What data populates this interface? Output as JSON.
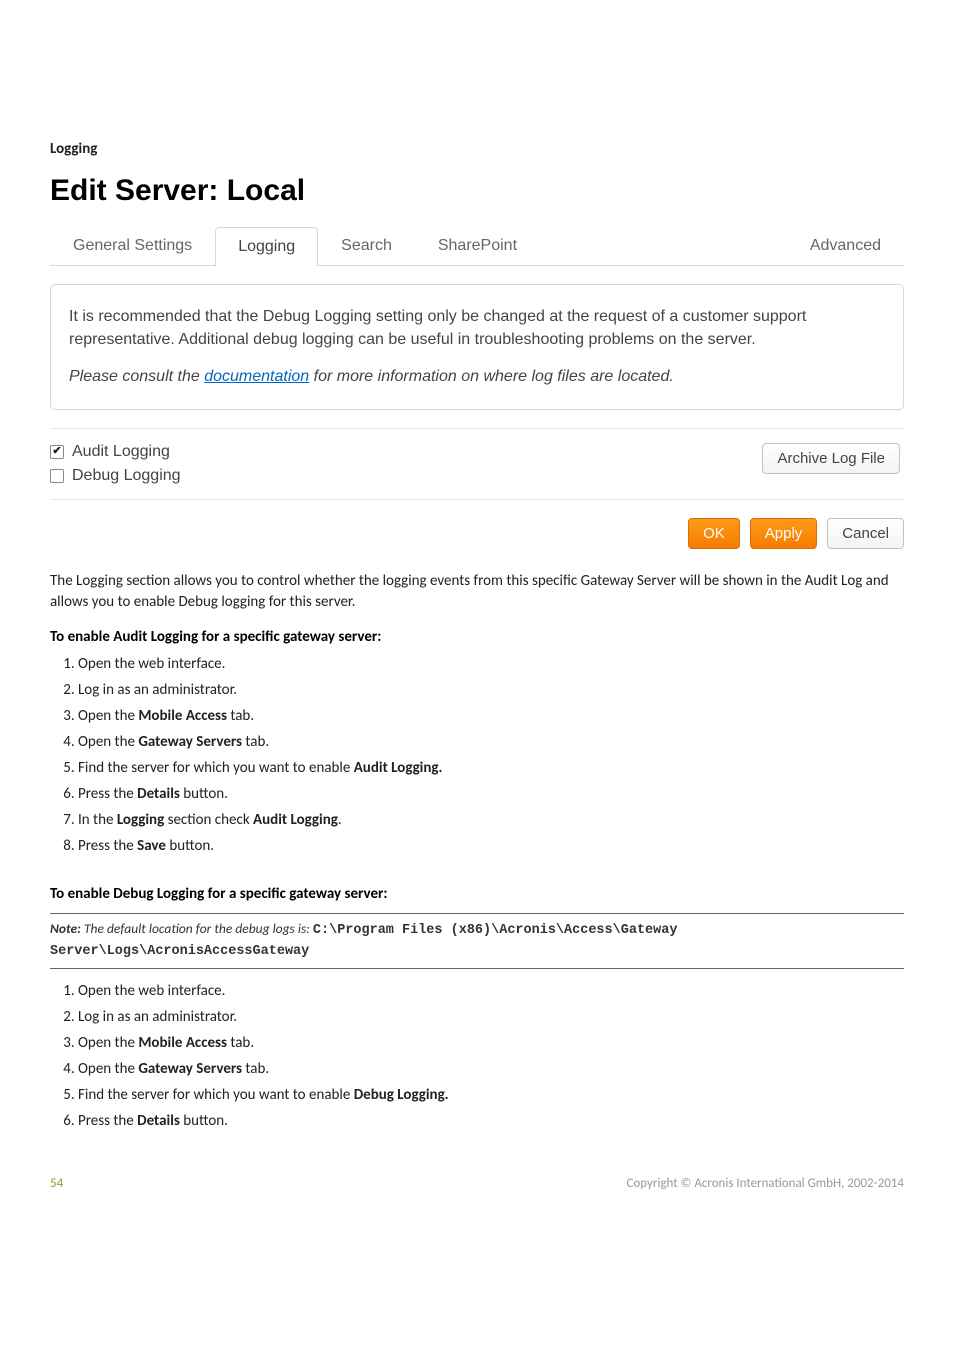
{
  "sectionLabel": "Logging",
  "pageTitle": "Edit Server: Local",
  "tabs": {
    "general": "General Settings",
    "logging": "Logging",
    "search": "Search",
    "sharepoint": "SharePoint",
    "advanced": "Advanced"
  },
  "infoBox": {
    "para": "It is recommended that the Debug Logging setting only be changed at the request of a customer support representative. Additional debug logging can be useful in troubleshooting problems on the server.",
    "noteBefore": "Please consult the ",
    "docLink": "documentation",
    "noteAfter": " for more information on where log files are located."
  },
  "checkboxes": {
    "audit": "Audit Logging",
    "debug": "Debug Logging"
  },
  "archiveBtn": "Archive Log File",
  "buttons": {
    "ok": "OK",
    "apply": "Apply",
    "cancel": "Cancel"
  },
  "descPara": "The Logging section allows you to control whether the logging events from this specific Gateway Server will be shown in the Audit Log and allows you to enable Debug logging for this server.",
  "audit": {
    "heading": "To enable Audit Logging for a specific gateway server:",
    "steps": [
      [
        {
          "t": "Open the web interface."
        }
      ],
      [
        {
          "t": "Log in as an administrator."
        }
      ],
      [
        {
          "t": "Open the "
        },
        {
          "t": "Mobile Access",
          "b": true
        },
        {
          "t": " tab."
        }
      ],
      [
        {
          "t": "Open the "
        },
        {
          "t": "Gateway Servers",
          "b": true
        },
        {
          "t": " tab."
        }
      ],
      [
        {
          "t": "Find the server for which you want to enable "
        },
        {
          "t": "Audit Logging.",
          "b": true
        }
      ],
      [
        {
          "t": "Press the "
        },
        {
          "t": "Details",
          "b": true
        },
        {
          "t": " button."
        }
      ],
      [
        {
          "t": "In the "
        },
        {
          "t": "Logging",
          "b": true
        },
        {
          "t": " section check "
        },
        {
          "t": "Audit Logging",
          "b": true
        },
        {
          "t": "."
        }
      ],
      [
        {
          "t": "Press the "
        },
        {
          "t": "Save",
          "b": true
        },
        {
          "t": " button."
        }
      ]
    ]
  },
  "debug": {
    "heading": "To enable Debug Logging for a specific gateway server:",
    "noteLabel": "Note:",
    "noteText": " The default location for the debug logs is: ",
    "notePath": "C:\\Program Files (x86)\\Acronis\\Access\\Gateway Server\\Logs\\AcronisAccessGateway",
    "steps": [
      [
        {
          "t": "Open the web interface."
        }
      ],
      [
        {
          "t": "Log in as an administrator."
        }
      ],
      [
        {
          "t": "Open the "
        },
        {
          "t": "Mobile Access",
          "b": true
        },
        {
          "t": " tab."
        }
      ],
      [
        {
          "t": "Open the "
        },
        {
          "t": "Gateway Servers",
          "b": true
        },
        {
          "t": " tab."
        }
      ],
      [
        {
          "t": "Find the server for which you want to enable "
        },
        {
          "t": "Debug Logging.",
          "b": true
        }
      ],
      [
        {
          "t": "Press the "
        },
        {
          "t": "Details",
          "b": true
        },
        {
          "t": " button."
        }
      ]
    ]
  },
  "footer": {
    "page": "54",
    "copyright": "Copyright © Acronis International GmbH, 2002-2014"
  }
}
